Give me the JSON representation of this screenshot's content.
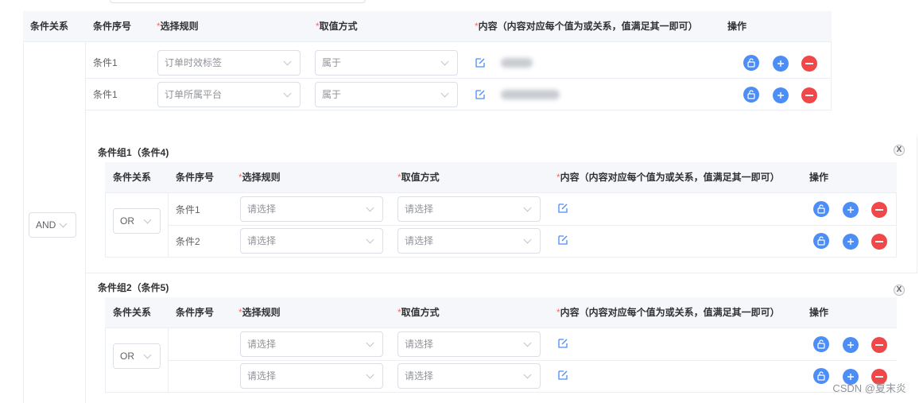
{
  "headers": {
    "relation": "条件关系",
    "seq": "条件序号",
    "rule": "选择规则",
    "method": "取值方式",
    "content": "内容（内容对应每个值为或关系，值满足其一即可）",
    "ops": "操作",
    "required_mark": "*"
  },
  "outer": {
    "relation_value": "AND",
    "rows": [
      {
        "seq": "条件1",
        "rule": "订单时效标签",
        "method": "属于"
      },
      {
        "seq": "条件1",
        "rule": "订单所属平台",
        "method": "属于"
      }
    ]
  },
  "groups": [
    {
      "title": "条件组1（条件4)",
      "relation_value": "OR",
      "rows": [
        {
          "seq": "条件1",
          "rule": "请选择",
          "method": "请选择"
        },
        {
          "seq": "条件2",
          "rule": "请选择",
          "method": "请选择"
        }
      ]
    },
    {
      "title": "条件组2（条件5)",
      "relation_value": "OR",
      "rows": [
        {
          "seq": "",
          "rule": "请选择",
          "method": "请选择"
        },
        {
          "seq": "",
          "rule": "请选择",
          "method": "请选择"
        }
      ]
    }
  ],
  "close_label": "X",
  "watermark": "CSDN @夏末炎",
  "icons": {
    "edit": "edit-icon",
    "lock": "unlock-icon",
    "add": "plus-icon",
    "remove": "minus-icon"
  },
  "colors": {
    "primary": "#4c8df6",
    "danger": "#f04848",
    "header_bg": "#f5f7fa",
    "required": "#f56c6c"
  }
}
